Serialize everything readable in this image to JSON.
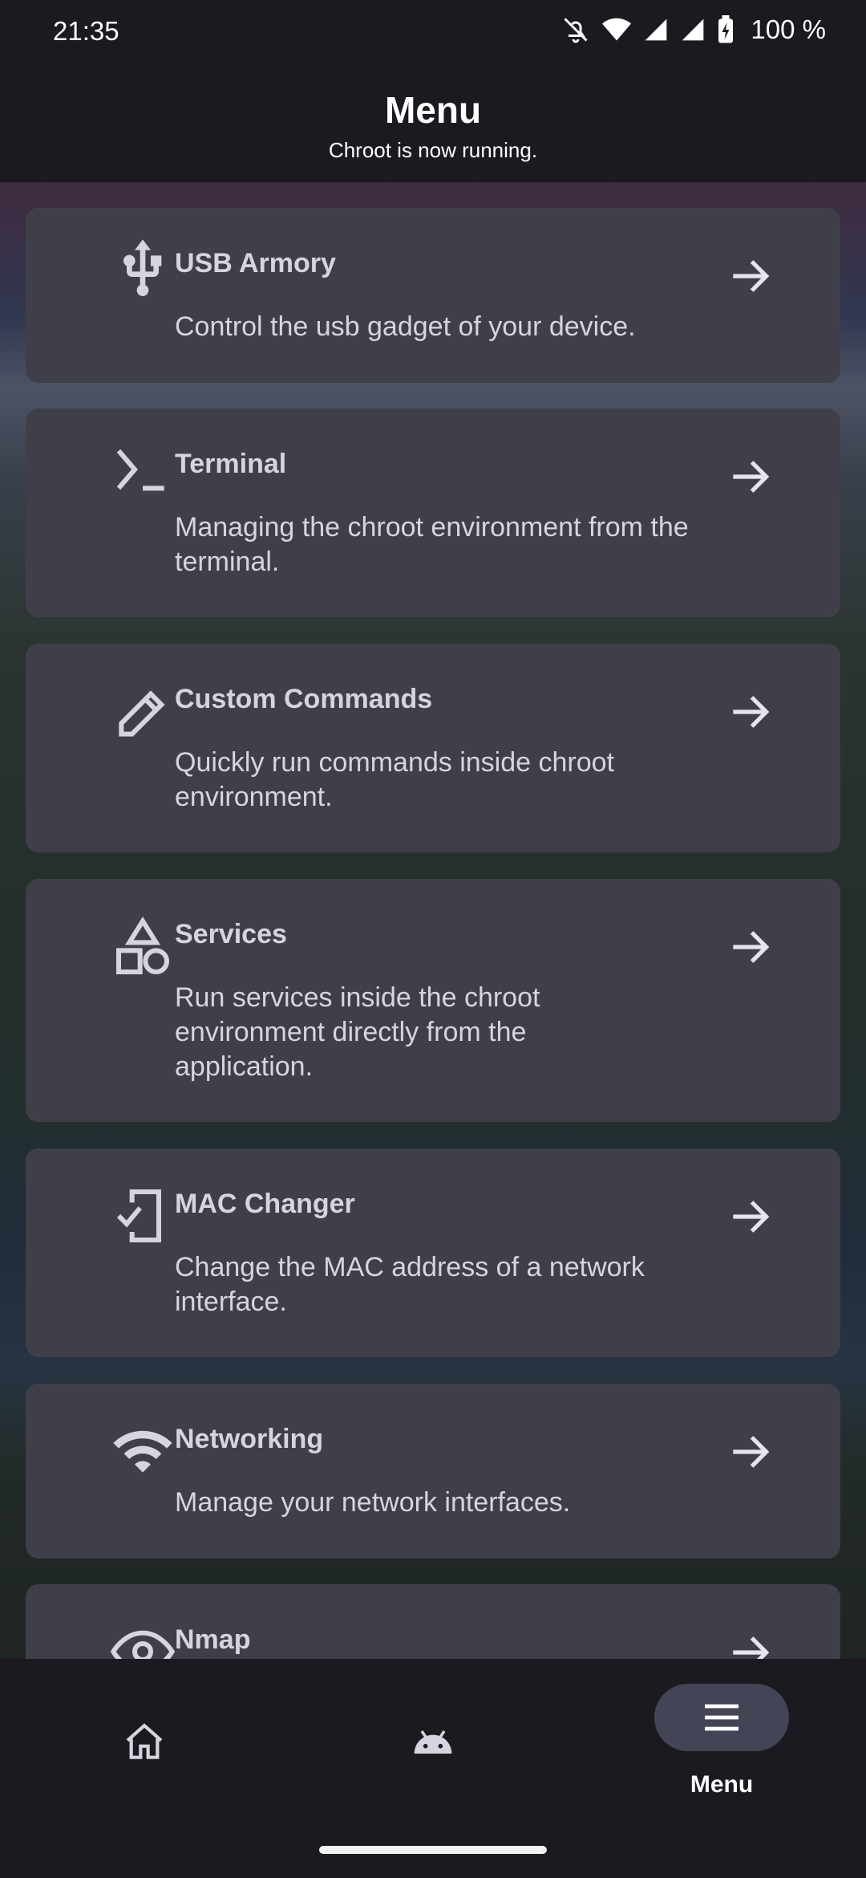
{
  "status_bar": {
    "time": "21:35",
    "battery": "100 %"
  },
  "header": {
    "title": "Menu",
    "subtitle": "Chroot is now running."
  },
  "menu": [
    {
      "title": "USB Armory",
      "description": "Control the usb gadget of your device.",
      "icon": "usb-icon"
    },
    {
      "title": "Terminal",
      "description": "Managing the chroot environment from the terminal.",
      "icon": "terminal-icon"
    },
    {
      "title": "Custom Commands",
      "description": "Quickly run commands inside chroot environment.",
      "icon": "pencil-icon"
    },
    {
      "title": "Services",
      "description": "Run services inside the chroot environment directly from the application.",
      "icon": "shapes-icon"
    },
    {
      "title": "MAC Changer",
      "description": "Change the MAC address of a network interface.",
      "icon": "phone-check-icon"
    },
    {
      "title": "Networking",
      "description": "Manage your network interfaces.",
      "icon": "wifi-icon"
    },
    {
      "title": "Nmap",
      "description": "",
      "icon": "eye-icon"
    }
  ],
  "bottom_nav": {
    "items": [
      {
        "icon": "home-icon",
        "label": ""
      },
      {
        "icon": "android-icon",
        "label": ""
      },
      {
        "icon": "menu-icon",
        "label": "Menu"
      }
    ]
  }
}
